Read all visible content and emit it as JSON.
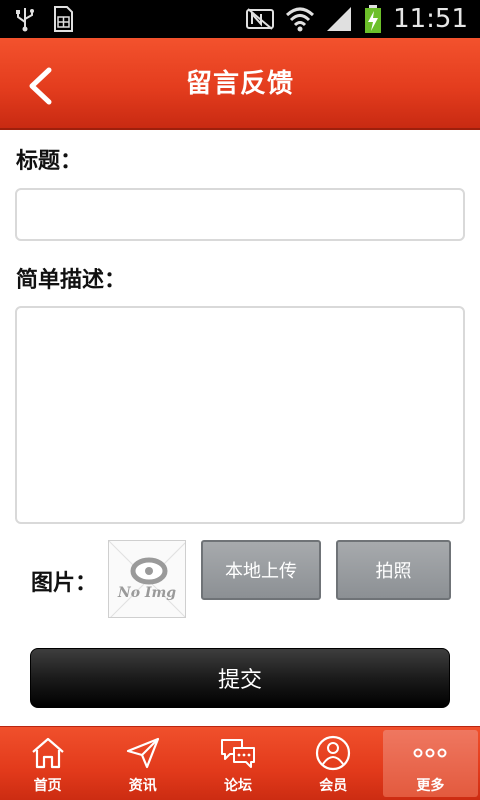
{
  "status_bar": {
    "time": "11:51",
    "icons": [
      "usb-icon",
      "sim-icon",
      "nfc-icon",
      "wifi-icon",
      "signal-icon",
      "battery-charging-icon"
    ]
  },
  "header": {
    "title": "留言反馈",
    "back_icon": "back-arrow-icon"
  },
  "form": {
    "title_label": "标题：",
    "title_value": "",
    "title_placeholder": "",
    "desc_label": "简单描述：",
    "desc_value": "",
    "desc_placeholder": "",
    "image_label": "图片：",
    "no_image_text": "No Img",
    "upload_button": "本地上传",
    "photo_button": "拍照",
    "submit_button": "提交"
  },
  "bottom_nav": {
    "items": [
      {
        "label": "首页",
        "icon": "home-icon"
      },
      {
        "label": "资讯",
        "icon": "paper-plane-icon"
      },
      {
        "label": "论坛",
        "icon": "chat-bubbles-icon"
      },
      {
        "label": "会员",
        "icon": "user-icon"
      },
      {
        "label": "更多",
        "icon": "more-dots-icon"
      }
    ],
    "active_index": 4
  },
  "colors": {
    "brand_red": "#e43d1e",
    "submit_black": "#1b1b1b",
    "secondary_button_gray": "#9a9da0"
  }
}
